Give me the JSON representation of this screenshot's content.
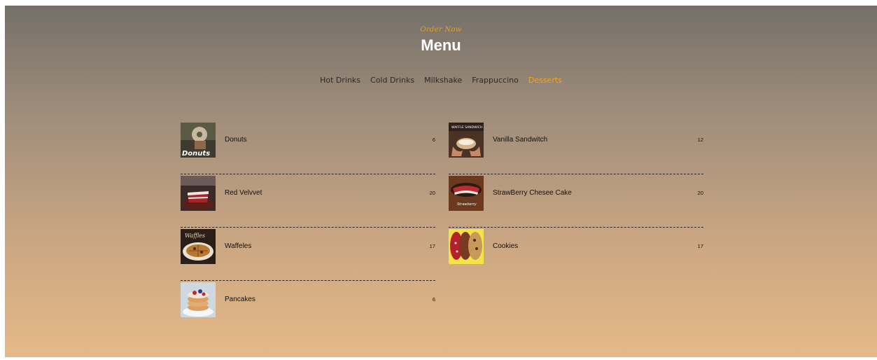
{
  "header": {
    "eyebrow": "Order Now",
    "title": "Menu"
  },
  "tabs": [
    {
      "label": "Hot Drinks",
      "active": false
    },
    {
      "label": "Cold Drinks",
      "active": false
    },
    {
      "label": "Milkshake",
      "active": false
    },
    {
      "label": "Frappuccino",
      "active": false
    },
    {
      "label": "Desserts",
      "active": true
    }
  ],
  "menu": {
    "left": [
      {
        "name": "Donuts",
        "price": "6",
        "image_text": "Donuts"
      },
      {
        "name": "Red Velvvet",
        "price": "20"
      },
      {
        "name": "Waffeles",
        "price": "17",
        "image_text": "Waffles"
      },
      {
        "name": "Pancakes",
        "price": "6"
      }
    ],
    "right": [
      {
        "name": "Vanilla Sandwitch",
        "price": "12",
        "image_text": "WAFFLE SANDWICH"
      },
      {
        "name": "StrawBerry Chesee Cake",
        "price": "20",
        "image_text": "Strawberry"
      },
      {
        "name": "Cookies",
        "price": "17"
      }
    ]
  },
  "colors": {
    "accent": "#f2a520",
    "eyebrow": "#e5a11f",
    "title": "#ffffff"
  }
}
